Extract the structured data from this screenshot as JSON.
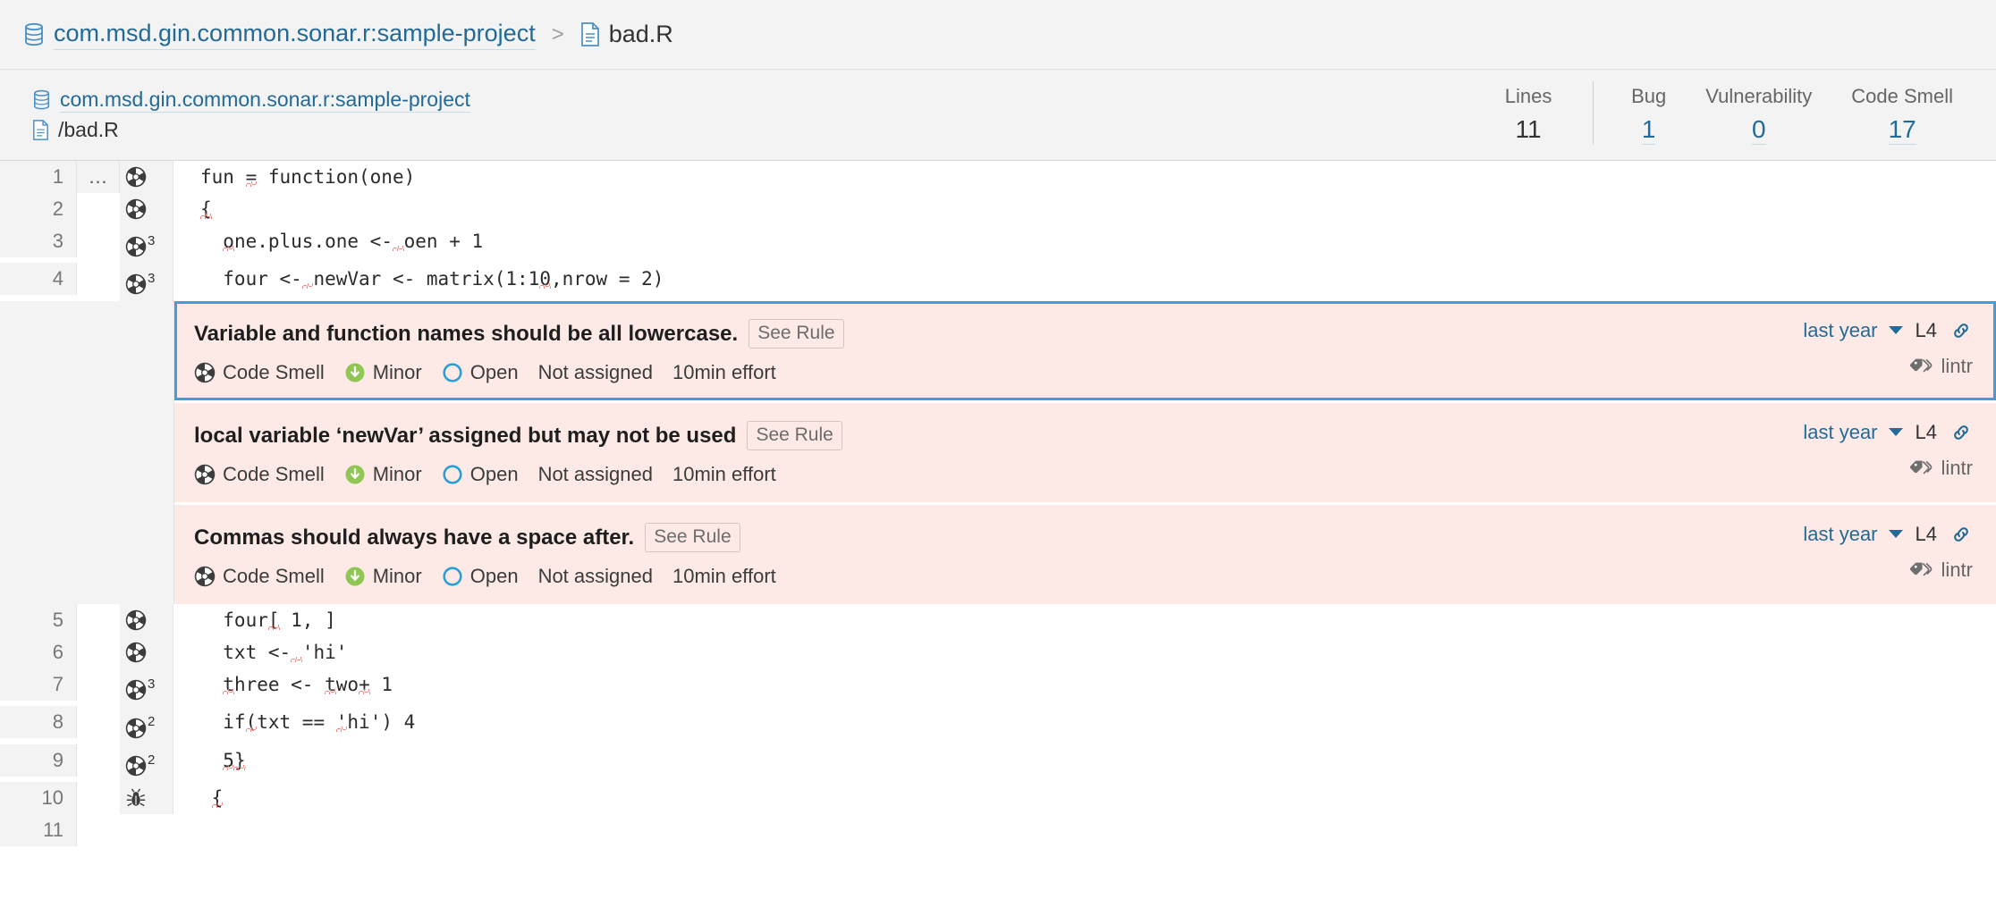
{
  "breadcrumb": {
    "project_icon": "database-icon",
    "project": "com.msd.gin.common.sonar.r:sample-project",
    "separator": ">",
    "file_icon": "file-icon",
    "file": "bad.R"
  },
  "file_header": {
    "project_icon": "database-icon",
    "project": "com.msd.gin.common.sonar.r:sample-project",
    "file_icon": "file-icon",
    "file": "/bad.R",
    "metrics": [
      {
        "label": "Lines",
        "value": "11",
        "is_link": false
      },
      {
        "label": "Bug",
        "value": "1",
        "is_link": true
      },
      {
        "label": "Vulnerability",
        "value": "0",
        "is_link": true
      },
      {
        "label": "Code Smell",
        "value": "17",
        "is_link": true
      }
    ]
  },
  "code": {
    "lines": [
      {
        "num": "1",
        "dots": "…",
        "icon": "code-smell-icon",
        "count": "",
        "text": "fun = function(one)",
        "underlines": [
          {
            "start": 4,
            "len": 1
          }
        ]
      },
      {
        "num": "2",
        "dots": "",
        "icon": "code-smell-icon",
        "count": "",
        "text": "{",
        "underlines": [
          {
            "start": 0,
            "len": 1
          }
        ]
      },
      {
        "num": "3",
        "dots": "",
        "icon": "code-smell-icon",
        "count": "3",
        "text": "  one.plus.one <- oen + 1",
        "underlines": [
          {
            "start": 2,
            "len": 1
          },
          {
            "start": 17,
            "len": 1
          }
        ]
      },
      {
        "num": "4",
        "dots": "",
        "icon": "code-smell-icon",
        "count": "3",
        "text": "  four <- newVar <- matrix(1:10,nrow = 2)",
        "underlines": [
          {
            "start": 9,
            "len": 1
          },
          {
            "start": 30,
            "len": 1
          }
        ]
      },
      {
        "num": "5",
        "dots": "",
        "icon": "code-smell-icon",
        "count": "",
        "text": "  four[ 1, ]",
        "underlines": [
          {
            "start": 6,
            "len": 1
          }
        ]
      },
      {
        "num": "6",
        "dots": "",
        "icon": "code-smell-icon",
        "count": "",
        "text": "  txt <- 'hi'",
        "underlines": [
          {
            "start": 8,
            "len": 1
          }
        ]
      },
      {
        "num": "7",
        "dots": "",
        "icon": "code-smell-icon",
        "count": "3",
        "text": "  three <- two+ 1",
        "underlines": [
          {
            "start": 2,
            "len": 1
          },
          {
            "start": 11,
            "len": 1
          },
          {
            "start": 14,
            "len": 1
          }
        ]
      },
      {
        "num": "8",
        "dots": "",
        "icon": "code-smell-icon",
        "count": "2",
        "text": "  if(txt == 'hi') 4",
        "underlines": [
          {
            "start": 4,
            "len": 1
          },
          {
            "start": 12,
            "len": 1
          }
        ]
      },
      {
        "num": "9",
        "dots": "",
        "icon": "code-smell-icon",
        "count": "2",
        "text": "  5}",
        "underlines": [
          {
            "start": 2,
            "len": 2
          }
        ]
      },
      {
        "num": "10",
        "dots": "",
        "icon": "bug-icon",
        "count": "",
        "text": " {",
        "underlines": [
          {
            "start": 1,
            "len": 1
          }
        ]
      },
      {
        "num": "11",
        "dots": "",
        "icon": "",
        "count": "",
        "text": "",
        "underlines": []
      }
    ],
    "issues_after_line": "4"
  },
  "issues": [
    {
      "selected": true,
      "title": "Variable and function names should be all lowercase.",
      "see_rule_label": "See Rule",
      "type_icon": "code-smell-icon",
      "type": "Code Smell",
      "severity_icon": "severity-minor-icon",
      "severity": "Minor",
      "status_icon": "status-open-icon",
      "status": "Open",
      "assignee": "Not assigned",
      "effort": "10min effort",
      "date": "last year",
      "caret_icon": "chevron-down-icon",
      "line_ref": "L4",
      "link_icon": "permalink-icon",
      "tag_icon": "tag-icon",
      "tag": "lintr"
    },
    {
      "selected": false,
      "title": "local variable ‘newVar’ assigned but may not be used",
      "see_rule_label": "See Rule",
      "type_icon": "code-smell-icon",
      "type": "Code Smell",
      "severity_icon": "severity-minor-icon",
      "severity": "Minor",
      "status_icon": "status-open-icon",
      "status": "Open",
      "assignee": "Not assigned",
      "effort": "10min effort",
      "date": "last year",
      "caret_icon": "chevron-down-icon",
      "line_ref": "L4",
      "link_icon": "permalink-icon",
      "tag_icon": "tag-icon",
      "tag": "lintr"
    },
    {
      "selected": false,
      "title": "Commas should always have a space after.",
      "see_rule_label": "See Rule",
      "type_icon": "code-smell-icon",
      "type": "Code Smell",
      "severity_icon": "severity-minor-icon",
      "severity": "Minor",
      "status_icon": "status-open-icon",
      "status": "Open",
      "assignee": "Not assigned",
      "effort": "10min effort",
      "date": "last year",
      "caret_icon": "chevron-down-icon",
      "line_ref": "L4",
      "link_icon": "permalink-icon",
      "tag_icon": "tag-icon",
      "tag": "lintr"
    }
  ],
  "colors": {
    "link": "#236a97",
    "issue_bg": "#fdeae7",
    "selected_border": "#4a9ad4",
    "gutter_bg": "#f3f3f3",
    "squiggle": "#f4776d",
    "severity_minor": "#90c653",
    "status_open": "#2a9fd6"
  }
}
